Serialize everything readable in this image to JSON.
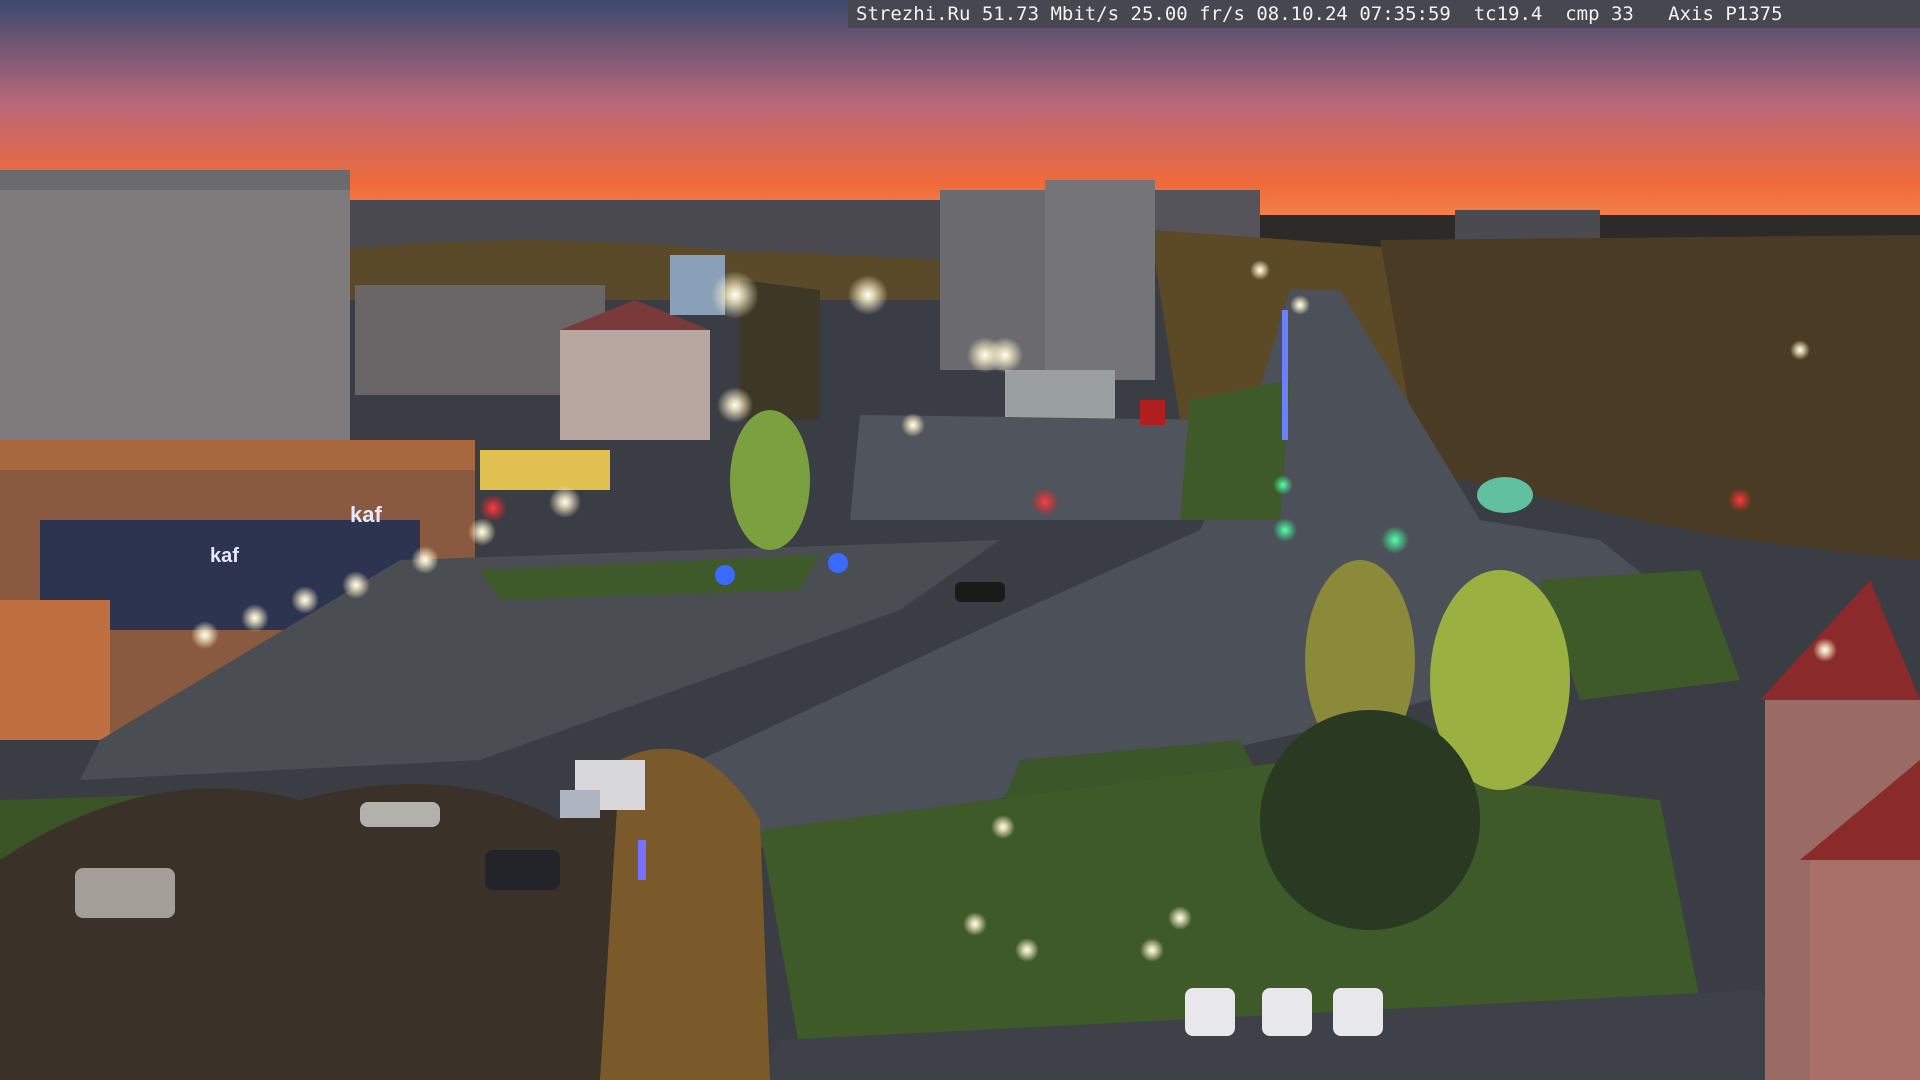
{
  "overlay": {
    "text": "Strezhi.Ru 51.73 Mbit/s 25.00 fr/s 08.10.24 07:35:59  tc19.4  cmp 33   Axis P1375"
  },
  "signs": {
    "store_left": "kaf",
    "store_right": "kaf"
  },
  "colors": {
    "sky_top": "#3b4a6e",
    "sky_horizon": "#f06a3a",
    "ground": "#3a3d44",
    "grass": "#3f5a2a",
    "streetlight": "#fff6d0"
  }
}
